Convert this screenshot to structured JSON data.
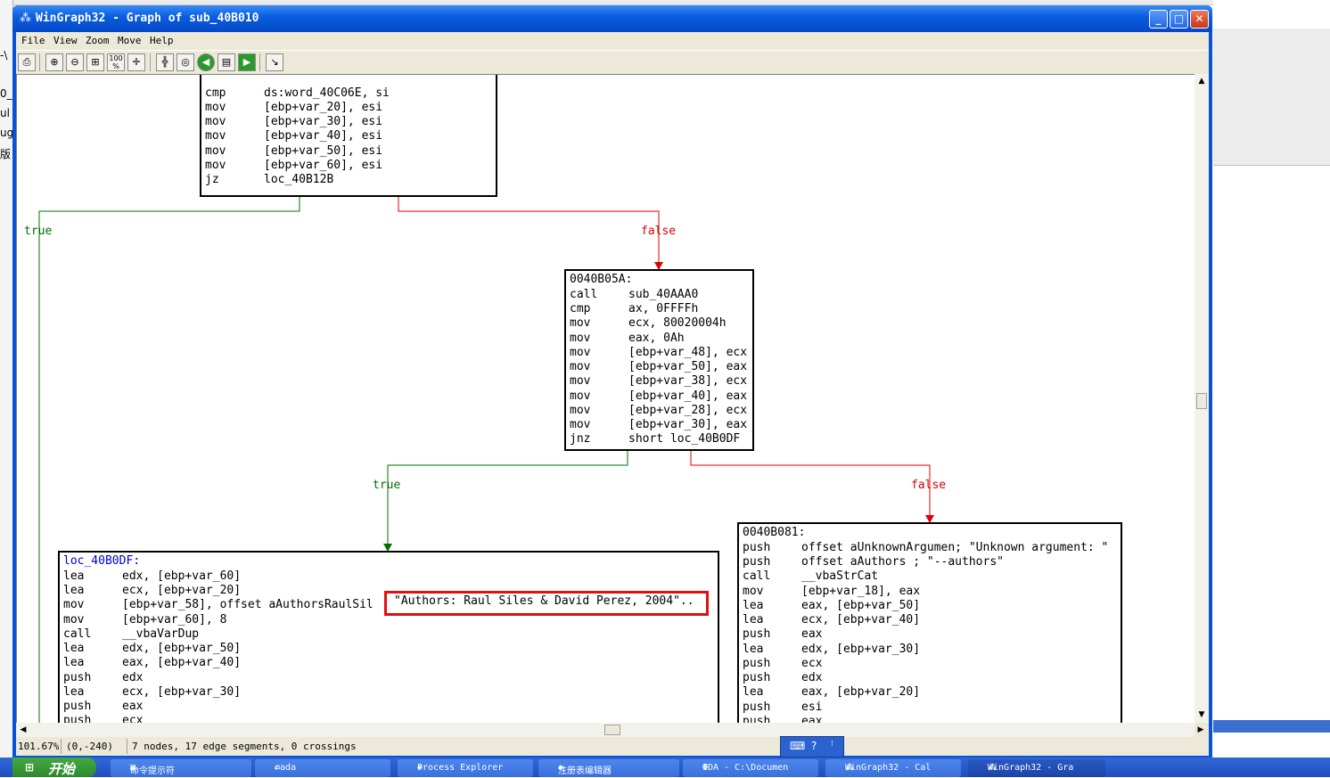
{
  "window": {
    "title": "WinGraph32 - Graph of sub_40B010",
    "minimize": "_",
    "maximize": "□",
    "close": "✕"
  },
  "menu": [
    "File",
    "View",
    "Zoom",
    "Move",
    "Help"
  ],
  "toolbar": {
    "tools": [
      "print-icon",
      "zoom-in-icon",
      "zoom-out-icon",
      "fit-icon",
      "zoom-100-icon",
      "center-icon",
      "move-icon",
      "rotate-icon",
      "back-icon",
      "overview-icon",
      "forward-icon",
      "pointer-icon"
    ],
    "zoom100_label": "100\n%"
  },
  "graph": {
    "node_top": {
      "lines": [
        {
          "mn": "cmp",
          "op": "ds:word_40C06E, si"
        },
        {
          "mn": "mov",
          "op": "[ebp+var_20], esi"
        },
        {
          "mn": "mov",
          "op": "[ebp+var_30], esi"
        },
        {
          "mn": "mov",
          "op": "[ebp+var_40], esi"
        },
        {
          "mn": "mov",
          "op": "[ebp+var_50], esi"
        },
        {
          "mn": "mov",
          "op": "[ebp+var_60], esi"
        },
        {
          "mn": "jz",
          "op": "loc_40B12B"
        }
      ]
    },
    "node_mid": {
      "header": "0040B05A:",
      "lines": [
        {
          "mn": "call",
          "op": "sub_40AAA0"
        },
        {
          "mn": "cmp",
          "op": "ax, 0FFFFh"
        },
        {
          "mn": "mov",
          "op": "ecx, 80020004h"
        },
        {
          "mn": "mov",
          "op": "eax, 0Ah"
        },
        {
          "mn": "mov",
          "op": "[ebp+var_48], ecx"
        },
        {
          "mn": "mov",
          "op": "[ebp+var_50], eax"
        },
        {
          "mn": "mov",
          "op": "[ebp+var_38], ecx"
        },
        {
          "mn": "mov",
          "op": "[ebp+var_40], eax"
        },
        {
          "mn": "mov",
          "op": "[ebp+var_28], ecx"
        },
        {
          "mn": "mov",
          "op": "[ebp+var_30], eax"
        },
        {
          "mn": "jnz",
          "op": "short loc_40B0DF"
        }
      ]
    },
    "node_left": {
      "header": "loc_40B0DF:",
      "lines": [
        {
          "mn": "lea",
          "op": "edx, [ebp+var_60]"
        },
        {
          "mn": "lea",
          "op": "ecx, [ebp+var_20]"
        },
        {
          "mn": "mov",
          "op": "[ebp+var_58], offset aAuthorsRaulSil"
        },
        {
          "mn": "mov",
          "op": "[ebp+var_60], 8"
        },
        {
          "mn": "call",
          "op": "__vbaVarDup"
        },
        {
          "mn": "lea",
          "op": "edx, [ebp+var_50]"
        },
        {
          "mn": "lea",
          "op": "eax, [ebp+var_40]"
        },
        {
          "mn": "push",
          "op": "edx"
        },
        {
          "mn": "lea",
          "op": "ecx, [ebp+var_30]"
        },
        {
          "mn": "push",
          "op": "eax"
        },
        {
          "mn": "push",
          "op": "ecx"
        }
      ],
      "highlight": "\"Authors: Raul Siles & David Perez, 2004\".."
    },
    "node_right": {
      "header": "0040B081:",
      "lines": [
        {
          "mn": "push",
          "op": "offset aUnknownArgumen; \"Unknown argument: \""
        },
        {
          "mn": "push",
          "op": "offset aAuthors ; \"--authors\""
        },
        {
          "mn": "call",
          "op": "__vbaStrCat"
        },
        {
          "mn": "mov",
          "op": "[ebp+var_18], eax"
        },
        {
          "mn": "lea",
          "op": "eax, [ebp+var_50]"
        },
        {
          "mn": "lea",
          "op": "ecx, [ebp+var_40]"
        },
        {
          "mn": "push",
          "op": "eax"
        },
        {
          "mn": "lea",
          "op": "edx, [ebp+var_30]"
        },
        {
          "mn": "push",
          "op": "ecx"
        },
        {
          "mn": "push",
          "op": "edx"
        },
        {
          "mn": "lea",
          "op": "eax, [ebp+var_20]"
        },
        {
          "mn": "push",
          "op": "esi"
        },
        {
          "mn": "push",
          "op": "eax"
        }
      ]
    },
    "edge_labels": {
      "true1": "true",
      "false1": "false",
      "true2": "true",
      "false2": "false"
    },
    "colors": {
      "true": "#007000",
      "false": "#e00000",
      "header": "#0000c8"
    }
  },
  "status": {
    "zoom": "101.67%",
    "coords": "(0,-240)",
    "info": "7 nodes, 17 edge segments, 0 crossings"
  },
  "taskbar": {
    "start": "开始",
    "tasks": [
      "命令提示符",
      "rada",
      "Process Explorer",
      "注册表编辑器",
      "IDA - C:\\Documen",
      "WinGraph32 - Cal",
      "WinGraph32 - Gra"
    ]
  },
  "background": {
    "left_fragments": [
      "-\\",
      "0_",
      "ul",
      "ug",
      "版"
    ]
  }
}
